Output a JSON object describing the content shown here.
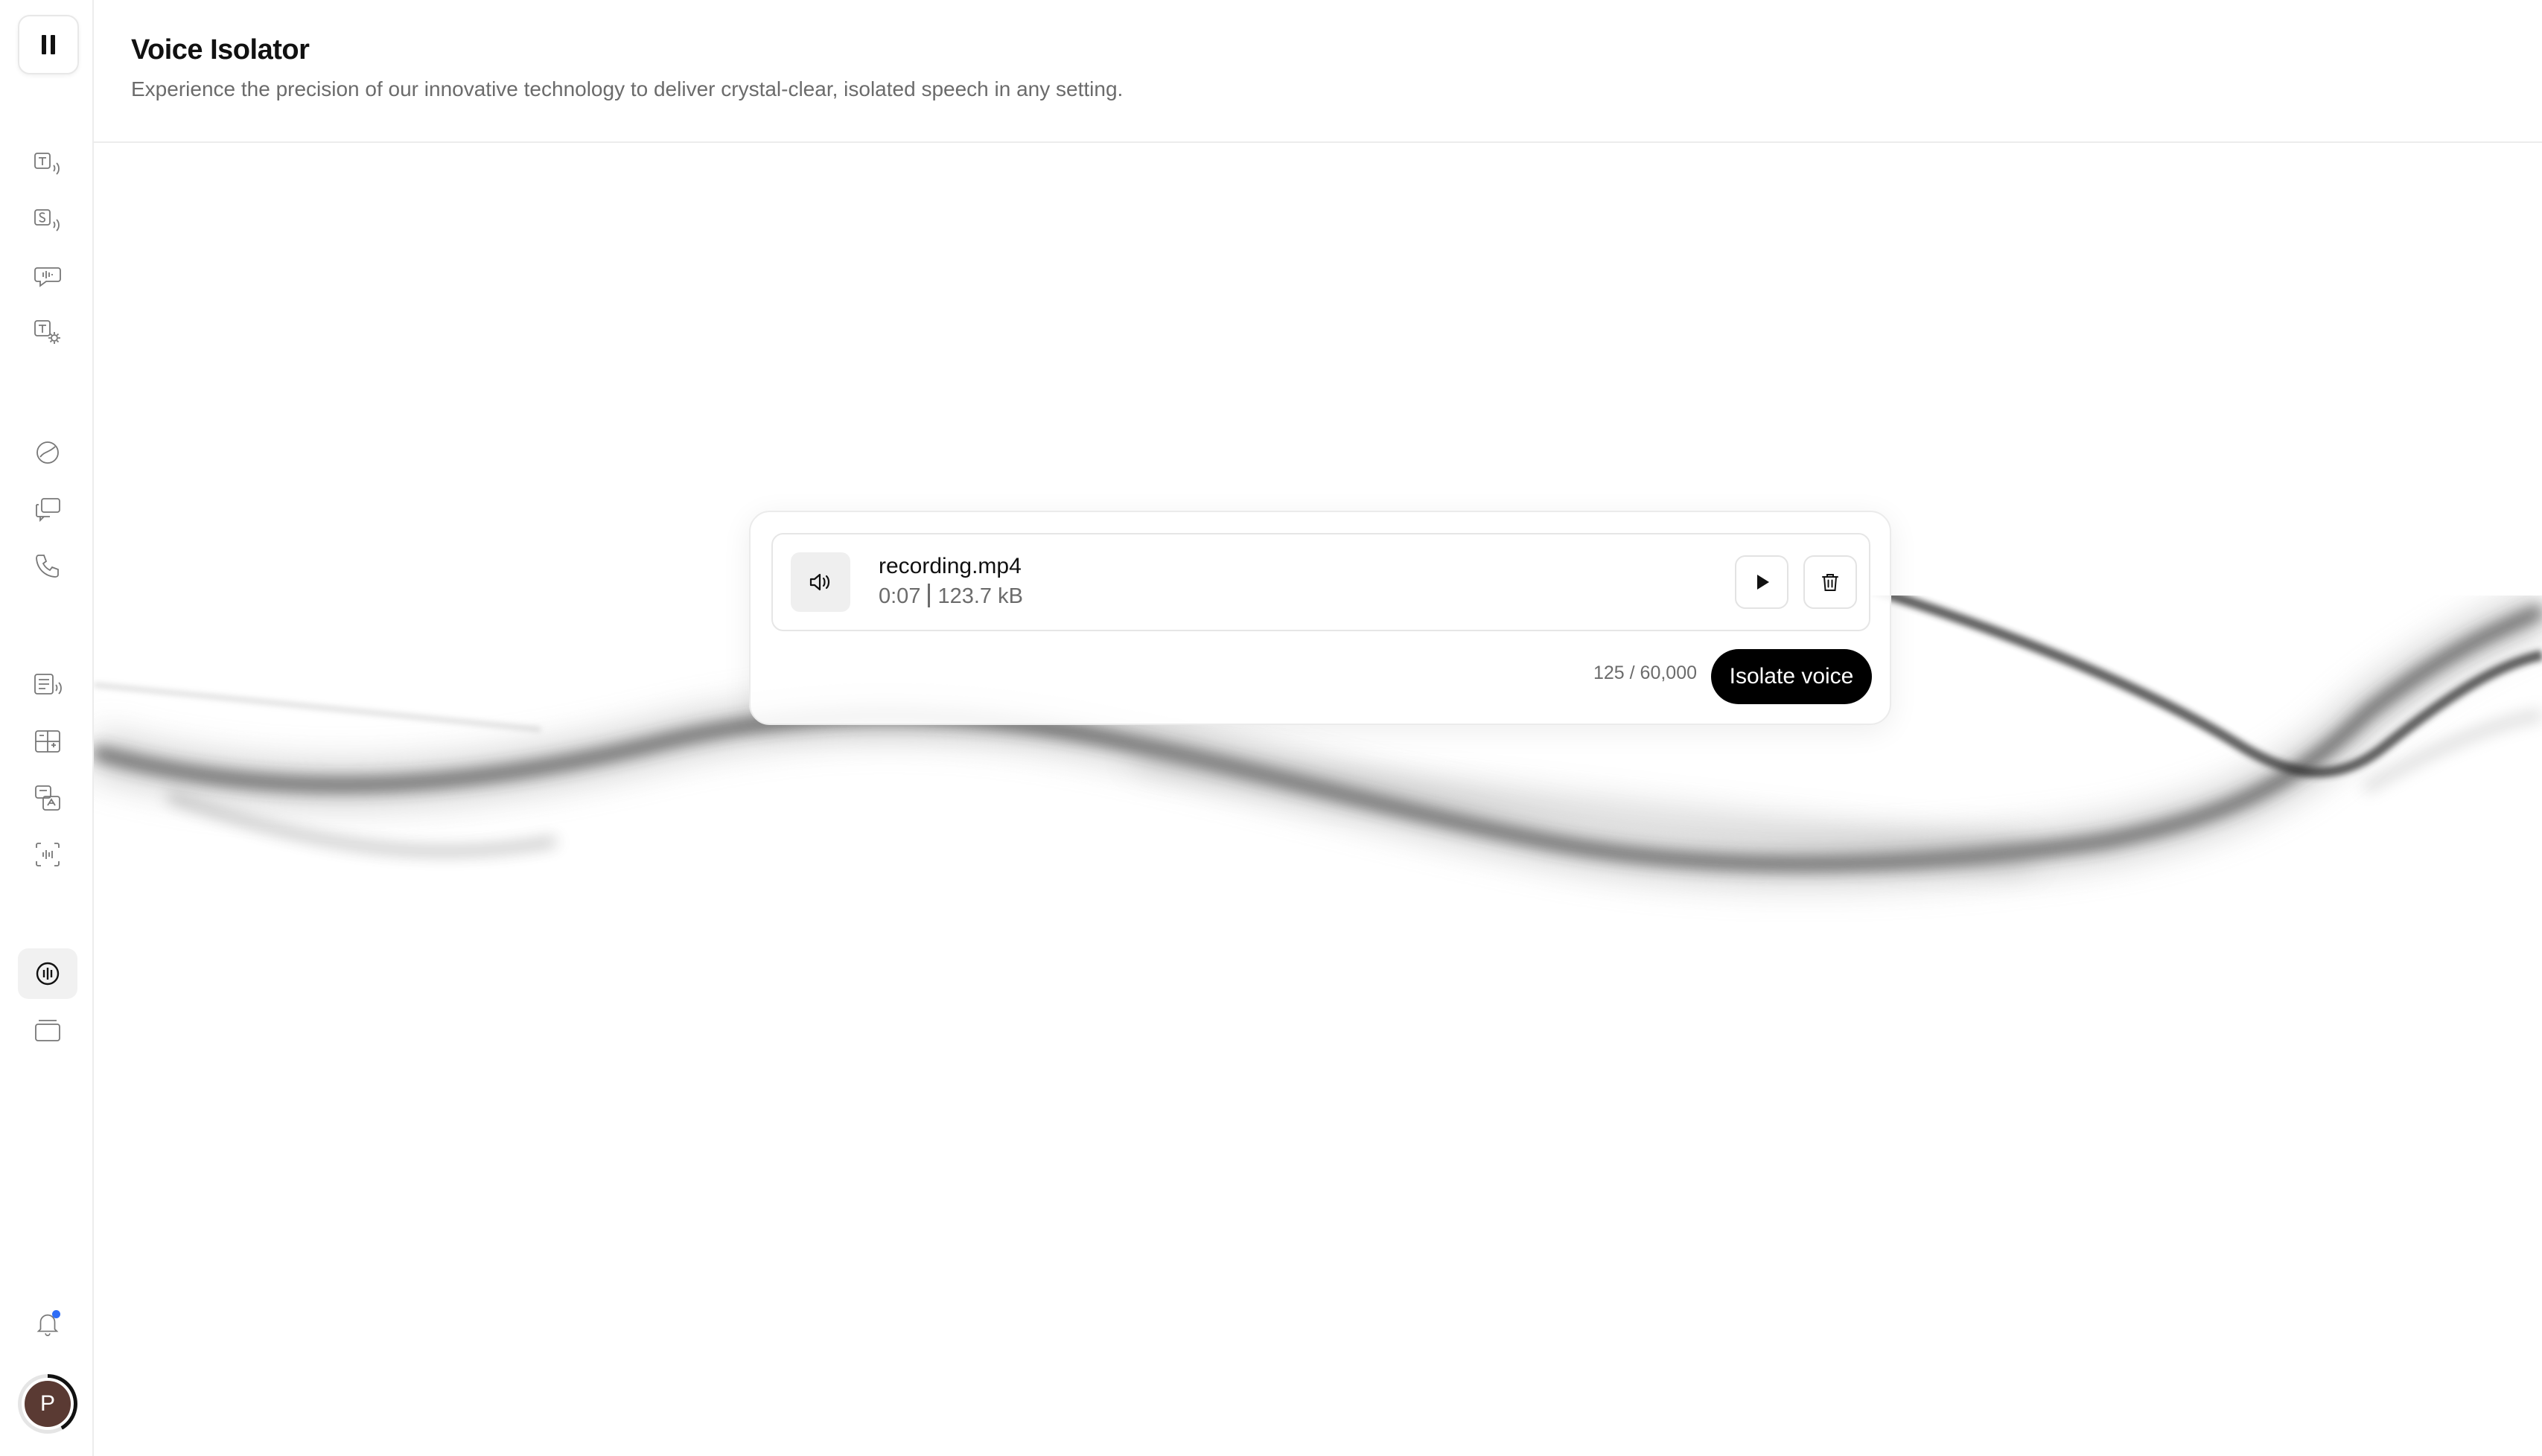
{
  "app": {
    "logo_icon": "pause-bars-logo"
  },
  "sidebar": {
    "items": [
      {
        "icon": "text-to-speech-icon",
        "active": false
      },
      {
        "icon": "speech-to-speech-icon",
        "active": false
      },
      {
        "icon": "sound-effects-icon",
        "active": false
      },
      {
        "icon": "voice-settings-icon",
        "active": false
      },
      {
        "icon": "voices-icon",
        "active": false
      },
      {
        "icon": "conversational-ai-icon",
        "active": false
      },
      {
        "icon": "phone-icon",
        "active": false
      },
      {
        "icon": "projects-icon",
        "active": false
      },
      {
        "icon": "dubbing-icon",
        "active": false
      },
      {
        "icon": "transcription-icon",
        "active": false
      },
      {
        "icon": "voice-changer-icon",
        "active": false
      },
      {
        "icon": "voice-isolator-icon",
        "active": true
      },
      {
        "icon": "library-icon",
        "active": false
      }
    ],
    "notifications": {
      "icon": "bell-icon",
      "has_unread": true,
      "dot_color": "#2f6df6"
    },
    "avatar": {
      "initial": "P",
      "color": "#5a3a33"
    }
  },
  "header": {
    "title": "Voice Isolator",
    "subtitle": "Experience the precision of our innovative technology to deliver crystal-clear, isolated speech in any setting."
  },
  "file": {
    "name": "recording.mp4",
    "duration": "0:07",
    "size": "123.7 kB",
    "type_icon": "speaker-icon"
  },
  "actions": {
    "char_count": "125 / 60,000",
    "isolate_label": "Isolate voice",
    "play_icon": "play-icon",
    "delete_icon": "trash-icon"
  },
  "colors": {
    "accent": "#000000",
    "muted_text": "#6b6b6b",
    "border": "#e6e6e6"
  }
}
